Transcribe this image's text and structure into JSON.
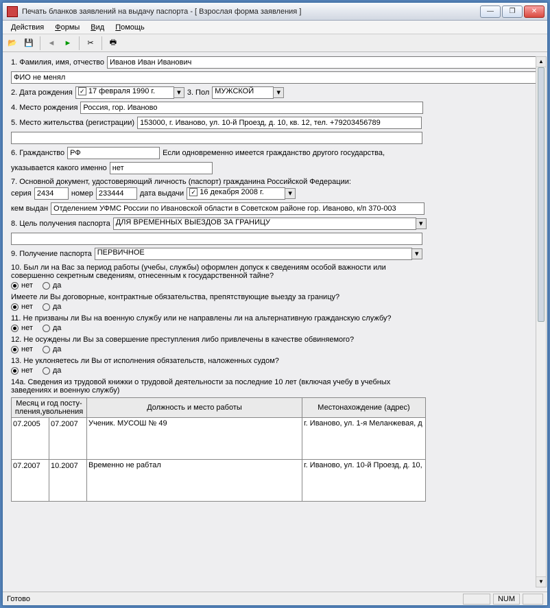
{
  "window": {
    "title": "Печать бланков заявлений на выдачу паспорта - [ Взрослая форма заявления ]"
  },
  "menu": {
    "actions": "Действия",
    "forms": "Формы",
    "view": "Вид",
    "help": "Помощь"
  },
  "form": {
    "f1_label": "1. Фамилия, имя, отчество",
    "f1_value": "Иванов Иван Иванович",
    "fio_changed": "ФИО не менял",
    "f2_label": "2. Дата рождения",
    "f2_value": "17 февраля  1990 г.",
    "f3_label": "3. Пол",
    "f3_value": "МУЖСКОЙ",
    "f4_label": "4. Место рождения",
    "f4_value": "Россия, гор. Иваново",
    "f5_label": "5. Место жительства (регистрации)",
    "f5_value": "153000, г. Иваново, ул. 10-й Проезд, д. 10, кв. 12, тел. +79203456789",
    "f5_extra": "",
    "f6_label": "6. Гражданство",
    "f6_value": "РФ",
    "f6_text": "Если одновременно имеется гражданство другого государства,",
    "f6_text2": "указывается какого именно",
    "f6_other": "нет",
    "f7_label": "7. Основной документ, удостоверяющий личность (паспорт) гражданина Российской Федерации:",
    "f7_series_l": "серия",
    "f7_series": "2434",
    "f7_num_l": "номер",
    "f7_num": "233444",
    "f7_date_l": "дата выдачи",
    "f7_date": "16 декабря  2008 г.",
    "f7_issued_l": "кем выдан",
    "f7_issued": "Отделением УФМС России по Ивановской области в Советском районе гор. Иваново, к/п 370-003",
    "f8_label": "8. Цель получения паспорта",
    "f8_value": "ДЛЯ ВРЕМЕННЫХ ВЫЕЗДОВ ЗА ГРАНИЦУ",
    "f8_extra": "",
    "f9_label": "9. Получение паспорта",
    "f9_value": "ПЕРВИЧНОЕ",
    "q10": "10. Был ли на Вас за период работы (учебы, службы) оформлен допуск к сведениям особой важности или совершенно секретным сведениям, отнесенным к государственной тайне?",
    "q10b": "Имеете ли Вы договорные, контрактные обязательства, препятствующие выезду за границу?",
    "q11": "11. Не призваны ли Вы на военную службу или не направлены ли на альтернативную гражданскую службу?",
    "q12": "12. Не осуждены ли Вы за совершение преступления либо привлечены в качестве обвиняемого?",
    "q13": "13.  Не уклоняетесь ли Вы от исполнения обязательств, наложенных судом?",
    "q14a": "14а. Сведения из трудовой книжки о трудовой деятельности за последние 10 лет (включая учебу в учебных заведениях и военную службу)",
    "no_l": "нет",
    "yes_l": "да",
    "table": {
      "col1": "Месяц и год посту- пления,увольнения",
      "col2": "Должность и место работы",
      "col3": "Местонахождение (адрес)",
      "rows": [
        {
          "from": "07.2005",
          "to": "07.2007",
          "pos": "Ученик. МУСОШ № 49",
          "addr": "г. Иваново, ул. 1-я Меланжевая, д"
        },
        {
          "from": "07.2007",
          "to": "10.2007",
          "pos": "Временно не рабтал",
          "addr": "г. Иваново, ул. 10-й Проезд, д. 10,"
        }
      ]
    }
  },
  "status": {
    "ready": "Готово",
    "num": "NUM"
  }
}
